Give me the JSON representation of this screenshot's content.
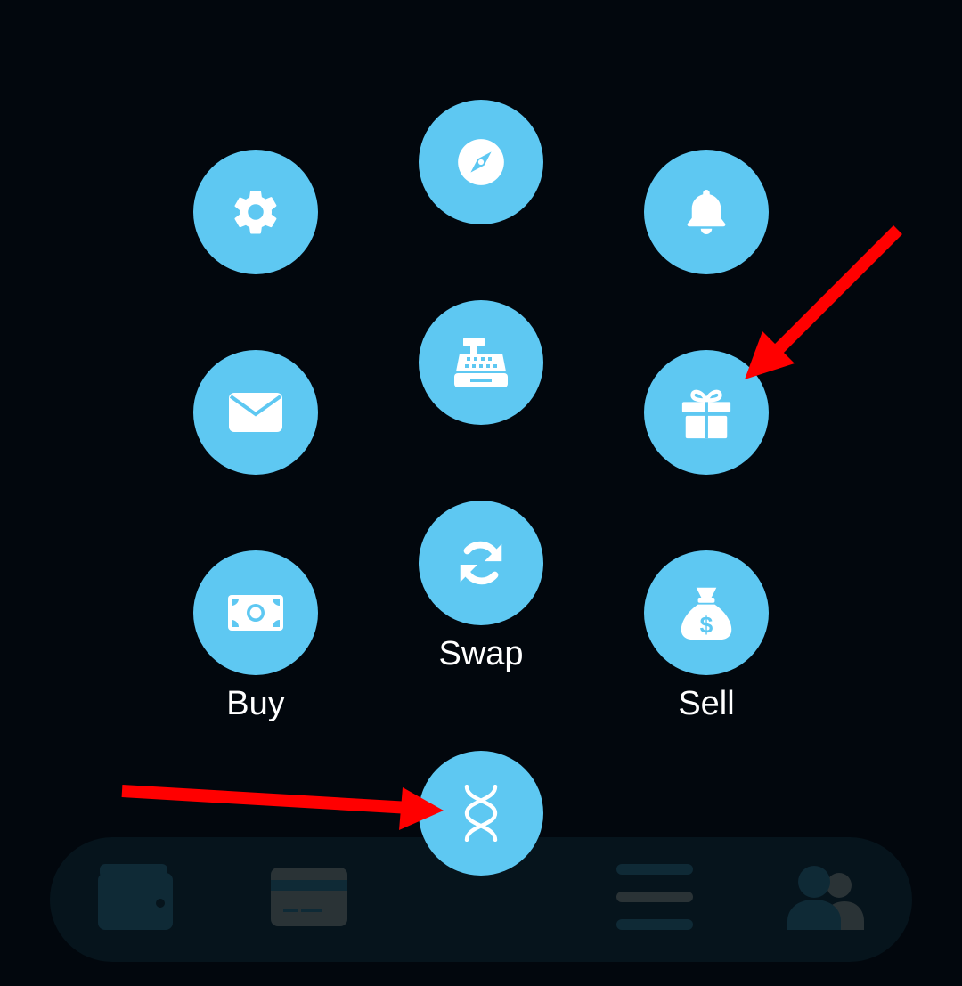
{
  "menu": {
    "buy_label": "Buy",
    "swap_label": "Swap",
    "sell_label": "Sell",
    "icons": [
      "gear-icon",
      "compass-icon",
      "bell-icon",
      "mail-icon",
      "cash-register-icon",
      "gift-icon",
      "cash-icon",
      "refresh-icon",
      "money-bag-icon",
      "dna-icon"
    ]
  },
  "bottom_nav": {
    "items": [
      "wallet-icon",
      "credit-card-icon",
      "menu-lines-icon",
      "users-icon"
    ]
  },
  "colors": {
    "background": "#02070d",
    "button": "#5ec8f2",
    "nav_background": "#06141c",
    "nav_icon": "#0f2a36",
    "annotation_arrow": "#ff0000"
  }
}
